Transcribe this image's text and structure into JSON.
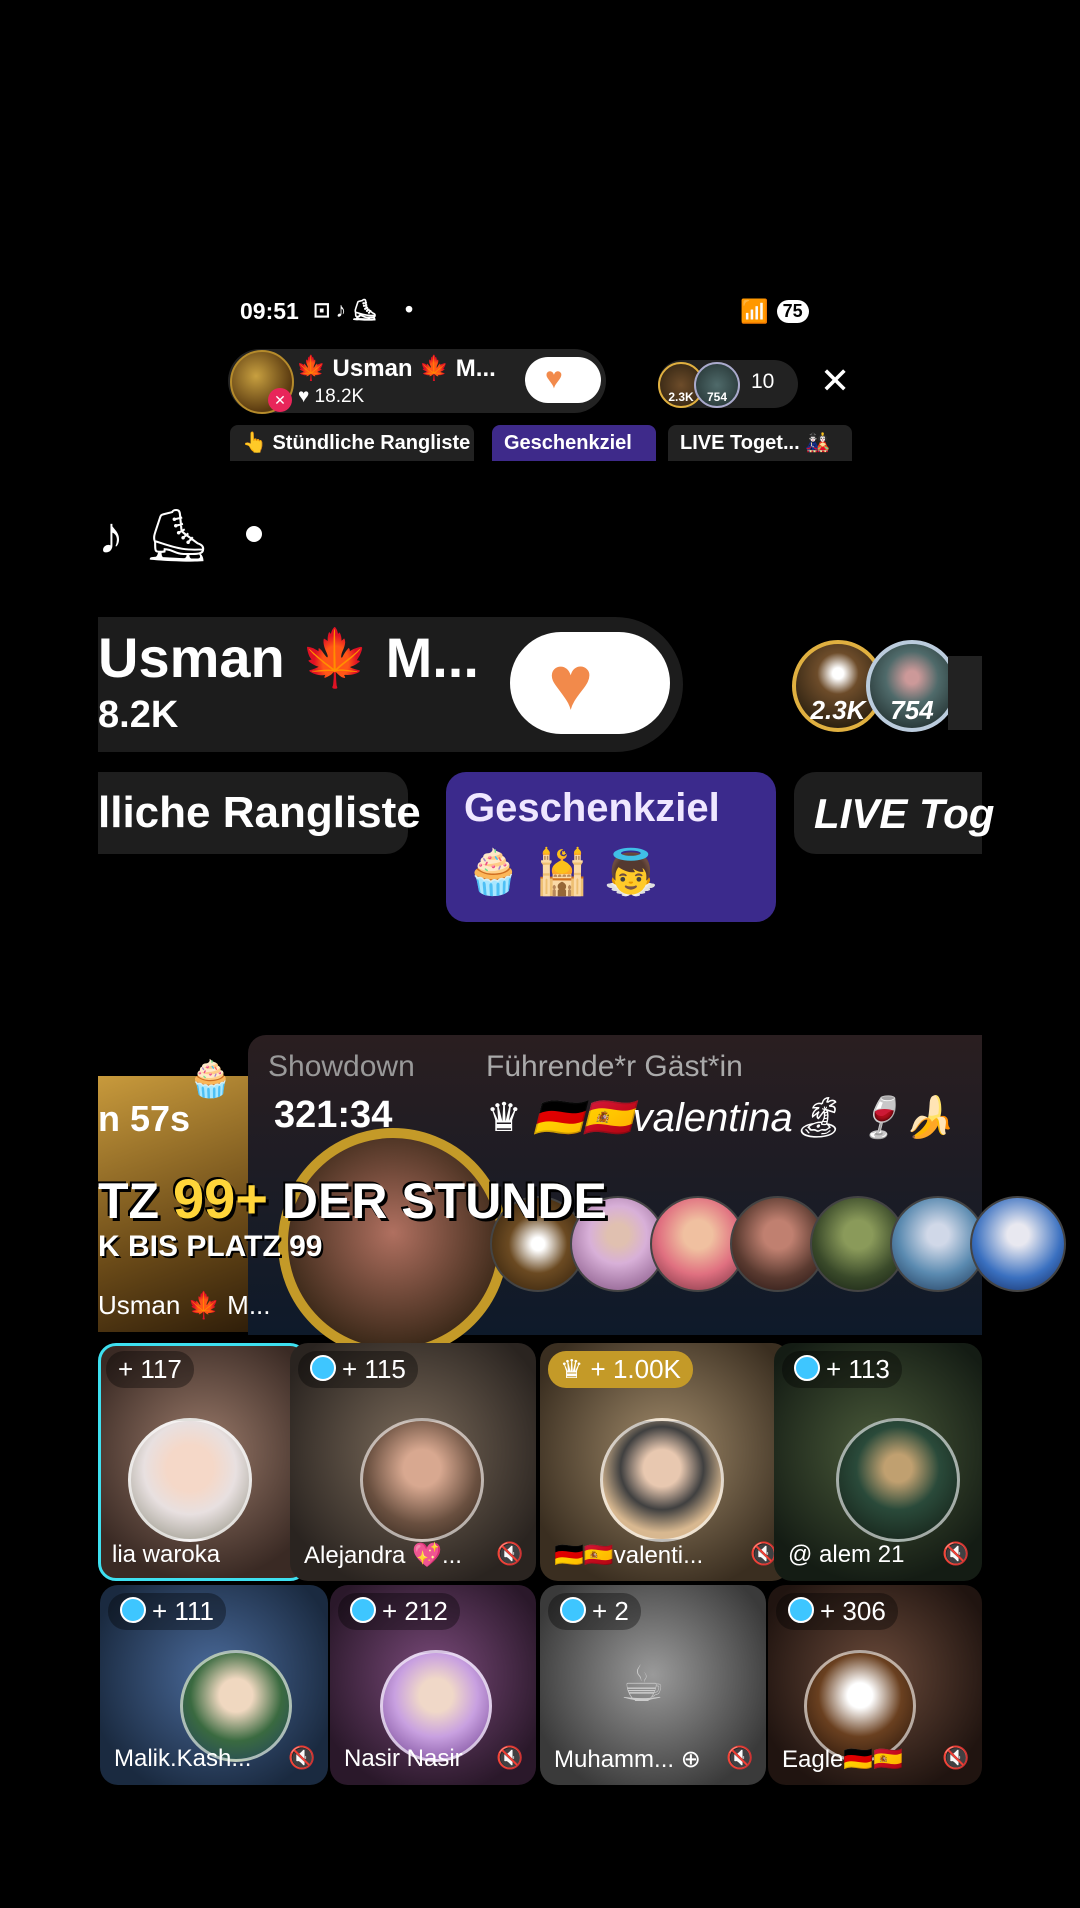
{
  "status": {
    "time": "09:51",
    "left_icons": "⊡♪⛸",
    "dot": "•",
    "signal": "📶",
    "battery": "75"
  },
  "header_small": {
    "host_name": "🍁 Usman 🍁 M...",
    "likes": "♥ 18.2K",
    "heart_icon": "heart-icon",
    "viewer_badges": [
      "2.3K",
      "754"
    ],
    "viewer_count": "10",
    "close": "✕",
    "tabs": [
      "👆 Stündliche Rangliste",
      "Geschenkziel",
      "LIVE Toget... 🎎"
    ]
  },
  "header_big": {
    "icons": "♪⛸",
    "host_name": "Usman 🍁 M...",
    "likes": "8.2K",
    "viewer_badges": [
      "2.3K",
      "754"
    ],
    "tab1": "lliche Rangliste",
    "tab2": "Geschenkziel",
    "tab2_gifts": "🧁🕌👼",
    "tab3": "LIVE Tog"
  },
  "showdown": {
    "timer": "n 57s",
    "label": "Showdown",
    "time": "321:34",
    "leader_label": "Führende*r Gäst*in",
    "leader_name": "♛ 🇩🇪🇪🇸valentina🏝 🍷🍌",
    "platz_prefix": "TZ ",
    "platz_num": "99+",
    "platz_suffix": " DER STUNDE",
    "platz_sub": "K BIS PLATZ 99",
    "host_name": "Usman 🍁 M..."
  },
  "guests": [
    {
      "badge": "+ 117",
      "gem": false,
      "gold": false,
      "name": "lia waroka",
      "muted": false
    },
    {
      "badge": "+ 115",
      "gem": true,
      "gold": false,
      "name": "Alejandra 💖...",
      "muted": true
    },
    {
      "badge": "♛ + 1.00K",
      "gem": false,
      "gold": true,
      "name": "🇩🇪🇪🇸valenti...",
      "muted": true
    },
    {
      "badge": "+ 113",
      "gem": true,
      "gold": false,
      "name": "@ alem 21",
      "muted": true
    },
    {
      "badge": "+ 111",
      "gem": true,
      "gold": false,
      "name": "Malik.Kash...",
      "muted": true
    },
    {
      "badge": "+ 212",
      "gem": true,
      "gold": false,
      "name": "Nasir Nasir",
      "muted": true
    },
    {
      "badge": "+ 2",
      "gem": true,
      "gold": false,
      "name": "Muhamm... ⊕",
      "muted": true
    },
    {
      "badge": "+ 306",
      "gem": true,
      "gold": false,
      "name": "Eagle🇩🇪🇪🇸",
      "muted": true
    }
  ],
  "colors": {
    "accent_purple": "#3b2a8c",
    "heart_orange": "#f28a4b",
    "gold": "#c49a28",
    "highlight_cyan": "#3ee0f0"
  }
}
